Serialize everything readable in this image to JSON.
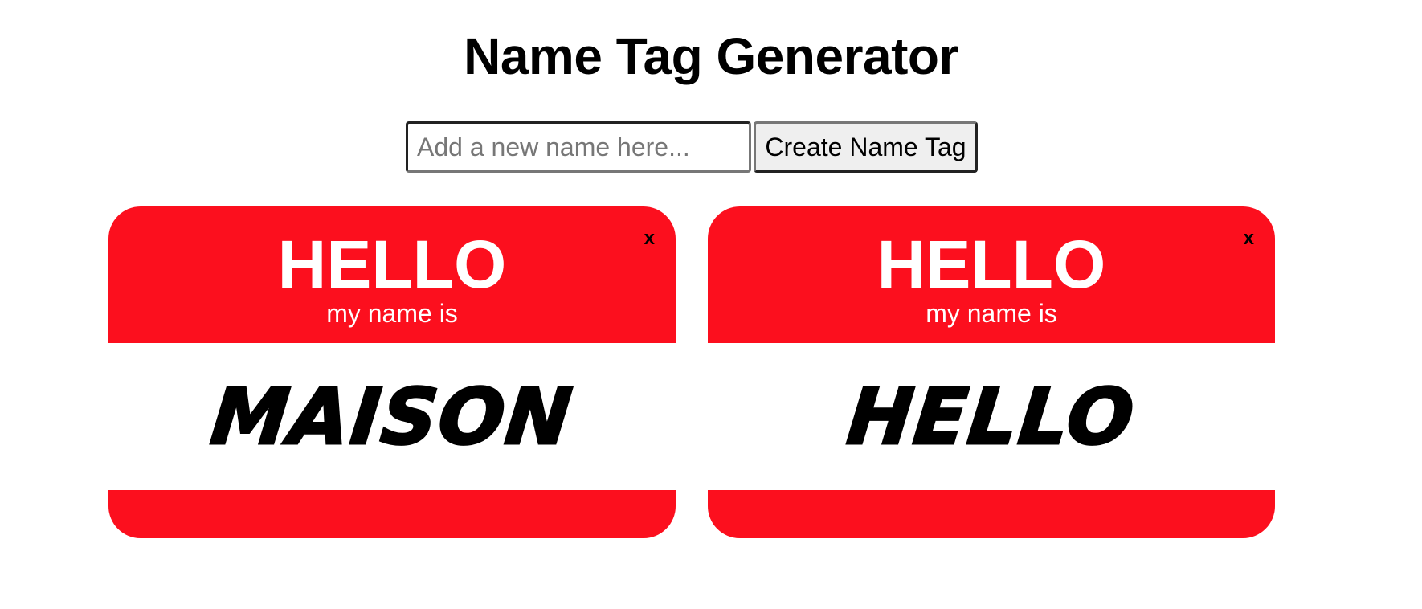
{
  "header": {
    "title": "Name Tag Generator"
  },
  "form": {
    "input_placeholder": "Add a new name here...",
    "input_value": "",
    "create_label": "Create Name Tag"
  },
  "tags": [
    {
      "greeting": "HELLO",
      "subtitle": "my name is",
      "name": "MAISON",
      "close_label": "x"
    },
    {
      "greeting": "HELLO",
      "subtitle": "my name is",
      "name": "HELLO",
      "close_label": "x"
    }
  ],
  "colors": {
    "tag_red": "#fc0f1e",
    "tag_white": "#ffffff",
    "text_black": "#000000"
  }
}
